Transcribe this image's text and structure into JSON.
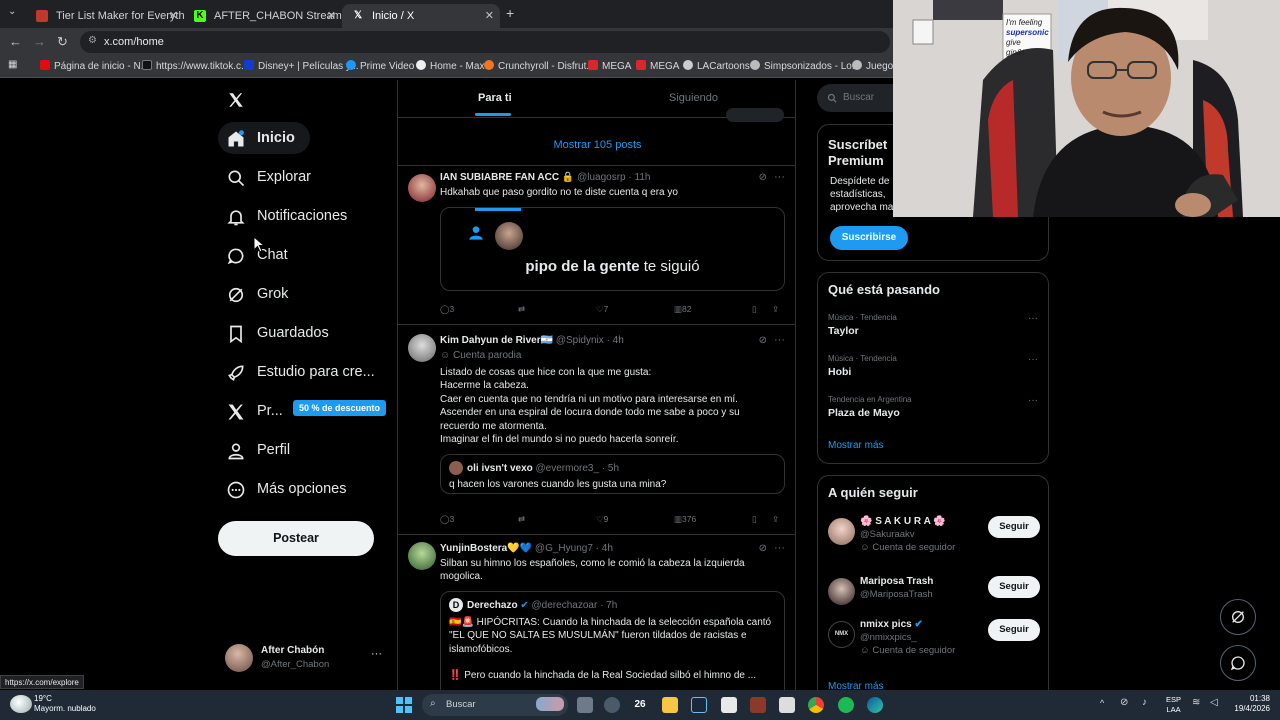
{
  "browser": {
    "tabs": [
      {
        "title": "Tier List Maker for Everything -",
        "icon": "tiermaker-icon"
      },
      {
        "title": "AFTER_CHABON Stream - Watc",
        "icon": "kick-icon"
      },
      {
        "title": "Inicio / X",
        "icon": "x-icon"
      }
    ],
    "url": "x.com/home",
    "bookmarks": [
      "Página de inicio - N...",
      "https://www.tiktok.c...",
      "Disney+ | Películas y...",
      "Prime Video",
      "Home - Max",
      "Crunchyroll - Disfrut...",
      "MEGA",
      "MEGA",
      "LACartoons",
      "Simpsonizados - Lo...",
      "Juegos"
    ]
  },
  "nav": {
    "items": [
      {
        "label": "Inicio",
        "icon": "home-icon"
      },
      {
        "label": "Explorar",
        "icon": "search-icon"
      },
      {
        "label": "Notificaciones",
        "icon": "bell-icon"
      },
      {
        "label": "Chat",
        "icon": "chat-icon"
      },
      {
        "label": "Grok",
        "icon": "grok-icon"
      },
      {
        "label": "Guardados",
        "icon": "bookmark-icon"
      },
      {
        "label": "Estudio para cre...",
        "icon": "rocket-icon"
      },
      {
        "label": "Pr...",
        "icon": "x-premium-icon"
      },
      {
        "label": "Perfil",
        "icon": "person-icon"
      },
      {
        "label": "Más opciones",
        "icon": "more-circle-icon"
      }
    ],
    "premium_badge": "50 % de descuento",
    "post_button": "Postear",
    "account": {
      "name": "After Chabón",
      "handle": "@After_Chabon"
    }
  },
  "timeline": {
    "tabs": [
      "Para ti",
      "Siguiendo"
    ],
    "show_posts": "Mostrar 105 posts",
    "tweets": [
      {
        "name": "IAN SUBIABRE FAN ACC",
        "lock": "🔒",
        "handle": "@luagosrp",
        "time": "· 11h",
        "text": "Hdkahab que paso gordito no te diste cuenta q era yo",
        "card": {
          "bold": "pipo de la gente",
          "rest": " te siguió"
        },
        "stats": {
          "replies": "3",
          "likes": "7",
          "views": "82"
        }
      },
      {
        "name": "Kim Dahyun de River🇦🇷",
        "handle": "@Spidynix",
        "time": "· 4h",
        "parody": "Cuenta parodia",
        "lines": [
          "Listado de cosas que hice con la que me gusta:",
          "Hacerme la cabeza.",
          "Caer en cuenta que no tendría ni un motivo para interesarse en mí.",
          "Ascender en una espiral de locura donde todo me sabe a poco y su",
          "recuerdo me atormenta.",
          "Imaginar el fin del mundo si no puedo hacerla sonreír."
        ],
        "quote": {
          "name": "oli ivsn't vexo",
          "handle": "@evermore3_",
          "time": "· 5h",
          "text": "q hacen los varones cuando les gusta una mina?"
        },
        "stats": {
          "replies": "3",
          "likes": "9",
          "views": "376"
        }
      },
      {
        "name": "YunjinBostera💛💙",
        "handle": "@G_Hyung7",
        "time": "· 4h",
        "lines": [
          "Silban su himno los españoles, como le comió la cabeza la izquierda",
          "mogolica."
        ],
        "quote": {
          "name": "Derechazo",
          "handle": "@derechazoar",
          "time": "· 7h",
          "lines": [
            "🇪🇸🚨 HIPÓCRITAS: Cuando la hinchada de la selección española cantó",
            "\"EL QUE NO SALTA ES MUSULMÁN\" fueron tildados de racistas e",
            "islamofóbicos.",
            "‼️ Pero cuando la hinchada de la Real Sociedad silbó el himno de ..."
          ]
        }
      }
    ]
  },
  "sidebar": {
    "search_placeholder": "Buscar",
    "premium": {
      "title_l1": "Suscríbet",
      "title_l2": "Premium",
      "desc_l1": "Despídete de",
      "desc_l2": "estadísticas,",
      "desc_l3": "aprovecha ma",
      "button": "Suscribirse"
    },
    "trends_title": "Qué está pasando",
    "trends": [
      {
        "category": "Música · Tendencia",
        "name": "Taylor"
      },
      {
        "category": "Música · Tendencia",
        "name": "Hobi"
      },
      {
        "category": "Tendencia en Argentina",
        "name": "Plaza de Mayo"
      }
    ],
    "show_more": "Mostrar más",
    "follow_title": "A quién seguir",
    "follow": [
      {
        "name": "🌸 S A K U R A 🌸",
        "handle": "@Sakuraakv",
        "follows_you": "Cuenta de seguidor",
        "button": "Seguir"
      },
      {
        "name": "Mariposa Trash",
        "handle": "@MariposaTrash",
        "button": "Seguir"
      },
      {
        "name": "nmixx pics",
        "handle": "@nmixxpics_",
        "follows_you": "Cuenta de seguidor",
        "button": "Seguir"
      }
    ],
    "show_more_2": "Mostrar más"
  },
  "webcam": {
    "sign_l1": "I'm feeling",
    "sign_l2": "supersonic",
    "sign_l3": "give",
    "sign_l4": "gin&t"
  },
  "status_url": "https://x.com/explore",
  "taskbar": {
    "temp": "19°C",
    "weather": "Mayorm. nublado",
    "search": "Buscar",
    "badge": "26",
    "lang_l1": "ESP",
    "lang_l2": "LAA",
    "time": "01:38",
    "date": "19/4/2026"
  },
  "colors": {
    "accent": "#1d9bf0",
    "background": "#000000",
    "border": "#2f3336",
    "muted": "#71767b"
  }
}
